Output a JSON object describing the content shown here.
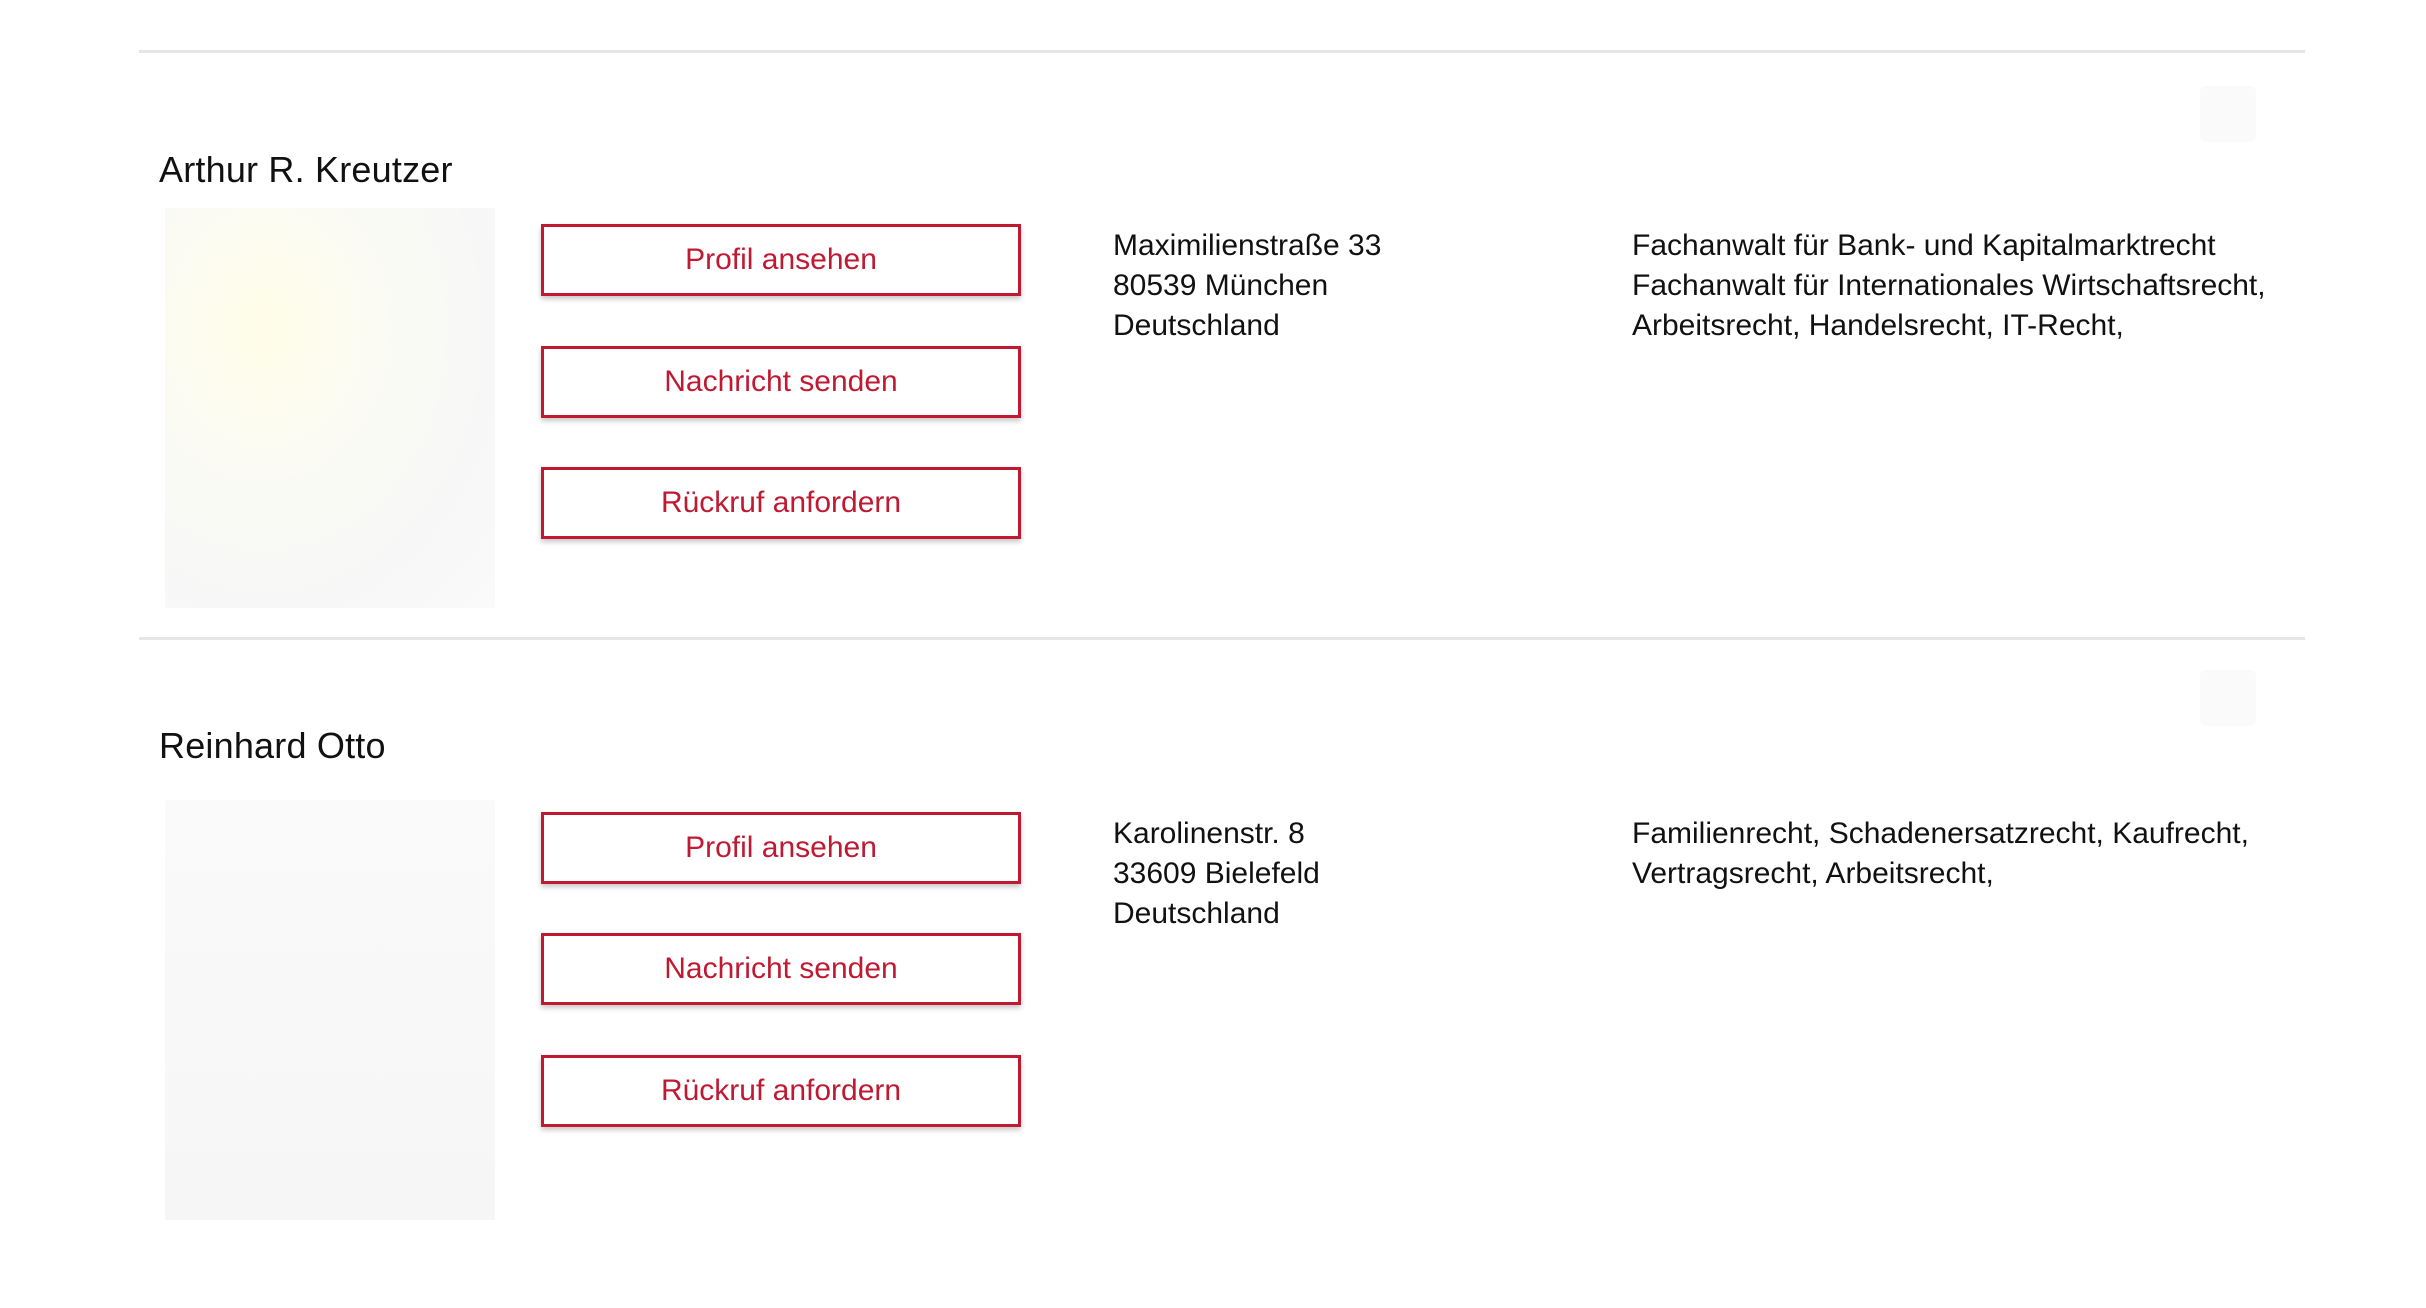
{
  "lawyers": [
    {
      "name": "Arthur R. Kreutzer",
      "buttons": {
        "profile": "Profil ansehen",
        "message": "Nachricht senden",
        "callback": "Rückruf anfordern"
      },
      "address": {
        "street": "Maximilienstraße 33",
        "city": "80539 München",
        "country": "Deutschland"
      },
      "specialties": [
        "Fachanwalt für Bank- und Kapitalmarktrecht",
        "Fachanwalt für Internationales Wirtschaftsrecht,",
        "Arbeitsrecht, Handelsrecht, IT-Recht,"
      ]
    },
    {
      "name": "Reinhard Otto",
      "buttons": {
        "profile": "Profil ansehen",
        "message": "Nachricht senden",
        "callback": "Rückruf anfordern"
      },
      "address": {
        "street": "Karolinenstr. 8",
        "city": "33609 Bielefeld",
        "country": "Deutschland"
      },
      "specialties": [
        "Familienrecht, Schadenersatzrecht, Kaufrecht,",
        "Vertragsrecht, Arbeitsrecht,"
      ]
    }
  ],
  "colors": {
    "accent": "#c01a33",
    "divider": "#e6e6e6",
    "text": "#111111"
  }
}
